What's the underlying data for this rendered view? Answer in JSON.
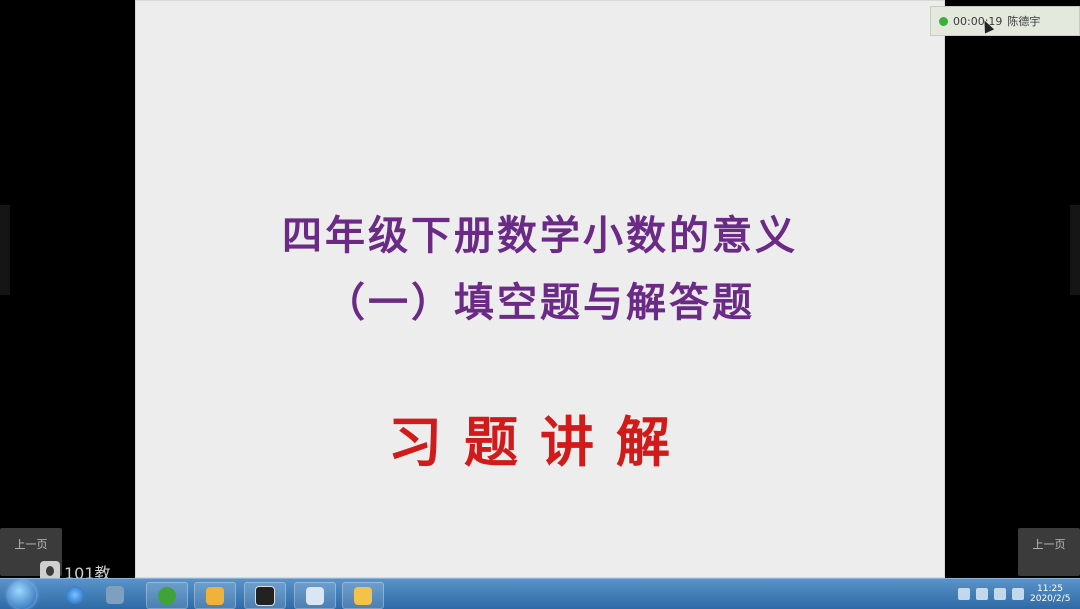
{
  "slide": {
    "title_line1": "四年级下册数学小数的意义",
    "title_line2": "（一）填空题与解答题",
    "subtitle": "习题讲解"
  },
  "nav": {
    "prev_left": "上一页",
    "prev_right": "上一页"
  },
  "watermark": {
    "text": "101教"
  },
  "recording": {
    "time": "00:00:19",
    "user": "陈德宇"
  },
  "taskbar": {
    "apps": [
      "browser-icon",
      "media-icon",
      "recorder-icon",
      "ppt-icon",
      "folder-icon"
    ],
    "clock_time": "11:25",
    "clock_date": "2020/2/5"
  },
  "colors": {
    "title": "#6a2a86",
    "subtitle": "#d11a1a",
    "slide_bg": "#ededed"
  }
}
